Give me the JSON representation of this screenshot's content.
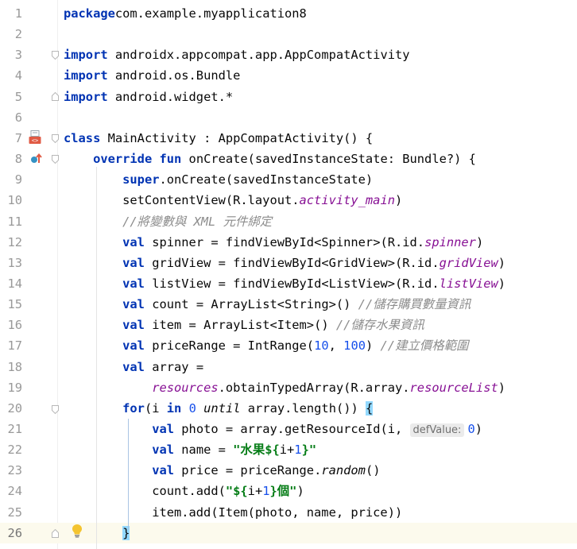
{
  "editor": {
    "lines": [
      {
        "num": "1",
        "segs": [
          [
            "kw",
            "package"
          ],
          [
            "",
            "com.example.myapplication8"
          ]
        ]
      },
      {
        "num": "2",
        "segs": []
      },
      {
        "num": "3",
        "segs": [
          [
            "kw",
            "import"
          ],
          [
            "",
            " androidx.appcompat.app.AppCompatActivity"
          ]
        ]
      },
      {
        "num": "4",
        "segs": [
          [
            "kw",
            "import"
          ],
          [
            "",
            " android.os.Bundle"
          ]
        ]
      },
      {
        "num": "5",
        "segs": [
          [
            "kw",
            "import"
          ],
          [
            "",
            " android.widget.*"
          ]
        ]
      },
      {
        "num": "6",
        "segs": []
      },
      {
        "num": "7",
        "segs": [
          [
            "kw",
            "class"
          ],
          [
            "",
            " MainActivity : AppCompatActivity() {"
          ]
        ]
      },
      {
        "num": "8",
        "segs": [
          [
            "",
            "    "
          ],
          [
            "kw",
            "override fun"
          ],
          [
            "",
            " onCreate(savedInstanceState: Bundle?) {"
          ]
        ]
      },
      {
        "num": "9",
        "segs": [
          [
            "",
            "        "
          ],
          [
            "kw",
            "super"
          ],
          [
            "",
            ".onCreate(savedInstanceState)"
          ]
        ]
      },
      {
        "num": "10",
        "segs": [
          [
            "",
            "        setContentView(R.layout."
          ],
          [
            "prop",
            "activity_main"
          ],
          [
            "",
            ")"
          ]
        ]
      },
      {
        "num": "11",
        "segs": [
          [
            "",
            "        "
          ],
          [
            "cmt",
            "//將變數與 XML 元件綁定"
          ]
        ]
      },
      {
        "num": "12",
        "segs": [
          [
            "",
            "        "
          ],
          [
            "kw",
            "val"
          ],
          [
            "",
            " spinner = findViewById<Spinner>(R.id."
          ],
          [
            "prop",
            "spinner"
          ],
          [
            "",
            ")"
          ]
        ]
      },
      {
        "num": "13",
        "segs": [
          [
            "",
            "        "
          ],
          [
            "kw",
            "val"
          ],
          [
            "",
            " gridView = findViewById<GridView>(R.id."
          ],
          [
            "prop",
            "gridView"
          ],
          [
            "",
            ")"
          ]
        ]
      },
      {
        "num": "14",
        "segs": [
          [
            "",
            "        "
          ],
          [
            "kw",
            "val"
          ],
          [
            "",
            " listView = findViewById<ListView>(R.id."
          ],
          [
            "prop",
            "listView"
          ],
          [
            "",
            ")"
          ]
        ]
      },
      {
        "num": "15",
        "segs": [
          [
            "",
            "        "
          ],
          [
            "kw",
            "val"
          ],
          [
            "",
            " count = ArrayList<String>() "
          ],
          [
            "cmt",
            "//儲存購買數量資訊"
          ]
        ]
      },
      {
        "num": "16",
        "segs": [
          [
            "",
            "        "
          ],
          [
            "kw",
            "val"
          ],
          [
            "",
            " item = ArrayList<Item>() "
          ],
          [
            "cmt",
            "//儲存水果資訊"
          ]
        ]
      },
      {
        "num": "17",
        "segs": [
          [
            "",
            "        "
          ],
          [
            "kw",
            "val"
          ],
          [
            "",
            " priceRange = IntRange("
          ],
          [
            "num",
            "10"
          ],
          [
            "",
            ", "
          ],
          [
            "num",
            "100"
          ],
          [
            "",
            ") "
          ],
          [
            "cmt",
            "//建立價格範圍"
          ]
        ]
      },
      {
        "num": "18",
        "segs": [
          [
            "",
            "        "
          ],
          [
            "kw",
            "val"
          ],
          [
            "",
            " array ="
          ]
        ]
      },
      {
        "num": "19",
        "segs": [
          [
            "",
            "            "
          ],
          [
            "prop",
            "resources"
          ],
          [
            "",
            ".obtainTypedArray(R.array."
          ],
          [
            "prop",
            "resourceList"
          ],
          [
            "",
            ")"
          ]
        ]
      },
      {
        "num": "20",
        "segs": [
          [
            "",
            "        "
          ],
          [
            "kw",
            "for"
          ],
          [
            "",
            "(i "
          ],
          [
            "kw",
            "in"
          ],
          [
            "",
            " "
          ],
          [
            "num",
            "0"
          ],
          [
            "",
            " "
          ],
          [
            "ital",
            "until"
          ],
          [
            "",
            " array.length()) "
          ],
          [
            "brace-hl",
            "{"
          ]
        ]
      },
      {
        "num": "21",
        "segs": [
          [
            "",
            "            "
          ],
          [
            "kw",
            "val"
          ],
          [
            "",
            " photo = array.getResourceId(i, "
          ],
          [
            "hint",
            "defValue:"
          ],
          [
            "num",
            "0"
          ],
          [
            "",
            ")"
          ]
        ]
      },
      {
        "num": "22",
        "segs": [
          [
            "",
            "            "
          ],
          [
            "kw",
            "val"
          ],
          [
            "",
            " name = "
          ],
          [
            "str",
            "\"水果${"
          ],
          [
            "",
            "i+"
          ],
          [
            "num",
            "1"
          ],
          [
            "str",
            "}\""
          ]
        ]
      },
      {
        "num": "23",
        "segs": [
          [
            "",
            "            "
          ],
          [
            "kw",
            "val"
          ],
          [
            "",
            " price = priceRange."
          ],
          [
            "ital",
            "random"
          ],
          [
            "",
            "()"
          ]
        ]
      },
      {
        "num": "24",
        "segs": [
          [
            "",
            "            count.add("
          ],
          [
            "str",
            "\"${"
          ],
          [
            "",
            "i+"
          ],
          [
            "num",
            "1"
          ],
          [
            "str",
            "}個\""
          ],
          [
            "",
            ")"
          ]
        ]
      },
      {
        "num": "25",
        "segs": [
          [
            "",
            "            item.add(Item(photo, name, price))"
          ]
        ]
      },
      {
        "num": "26",
        "segs": [
          [
            "",
            "        "
          ],
          [
            "brace-hl",
            "}"
          ]
        ]
      }
    ],
    "current_line": 26
  },
  "colors": {
    "keyword": "#0033b3",
    "number": "#1750eb",
    "string": "#067d17",
    "comment": "#8c8c8c",
    "property": "#871094",
    "brace_highlight": "#93d9ff",
    "current_line_bg": "#fcfaed"
  },
  "gutter_icons": {
    "line7": "android-activity-icon",
    "line8": "override-marker-icon",
    "line26": "intention-bulb-icon"
  }
}
